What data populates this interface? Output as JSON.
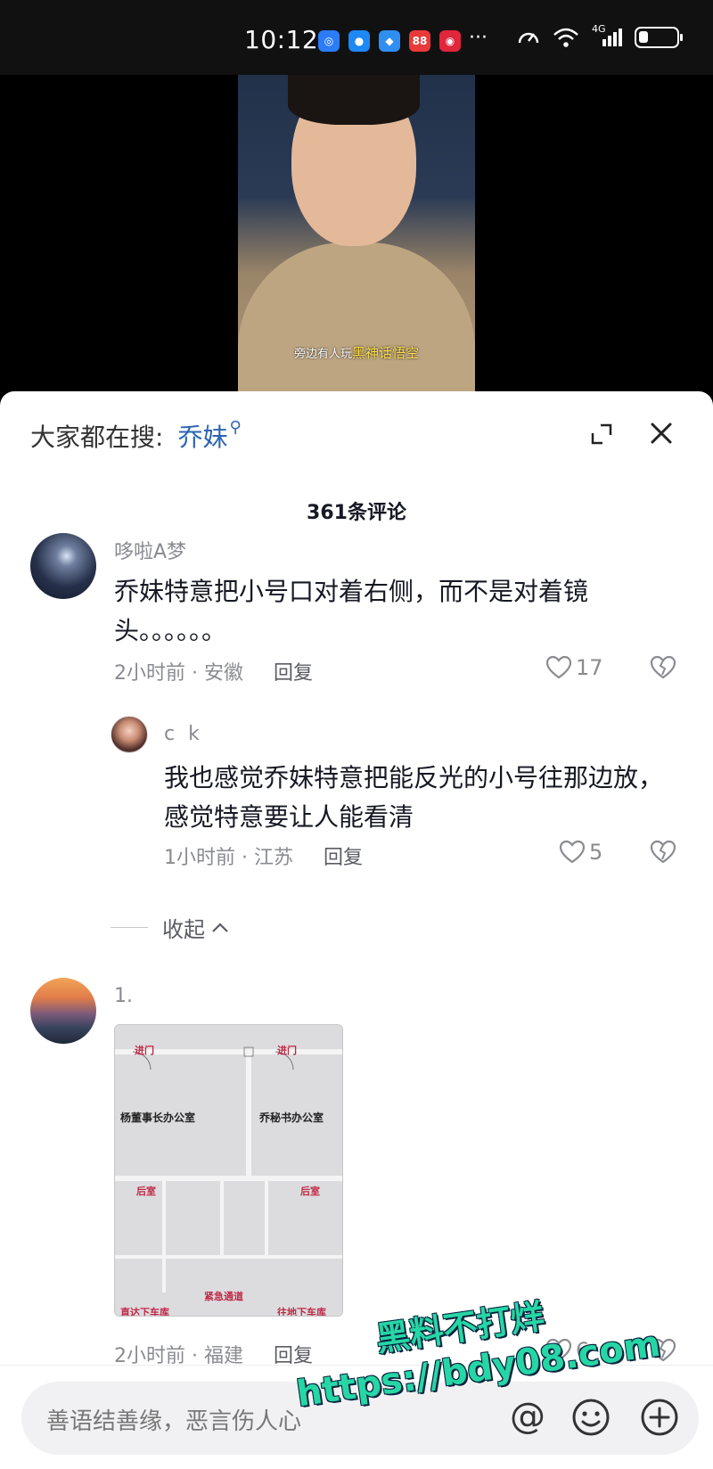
{
  "status_bar": {
    "time": "10:12",
    "notification_icons": [
      {
        "name": "app-icon-blue-1",
        "color": "#2b7cf6",
        "glyph": "◎"
      },
      {
        "name": "message-icon",
        "color": "#1e88f5",
        "glyph": "●"
      },
      {
        "name": "app-icon-blue-2",
        "color": "#2f8ef2",
        "glyph": "◆"
      },
      {
        "name": "app-icon-red-1",
        "color": "#e83a3a",
        "glyph": "88"
      },
      {
        "name": "app-icon-red-2",
        "color": "#e0263b",
        "glyph": "◉"
      }
    ],
    "more": "···",
    "network": "4G"
  },
  "video": {
    "subtitle_prefix": "旁边有人玩",
    "subtitle_highlight": "黑神话悟空"
  },
  "panel": {
    "search_label": "大家都在搜:",
    "search_term": "乔妹",
    "comments_count": "361条评论"
  },
  "comments": [
    {
      "username": "哆啦A梦",
      "text": "乔妹特意把小号口对着右侧，而不是对着镜头。。。。。。",
      "time_location": "2小时前 · 安徽",
      "reply_label": "回复",
      "likes": "17"
    },
    {
      "username": "c k",
      "text": "我也感觉乔妹特意把能反光的小号往那边放，感觉特意要让人能看清",
      "time_location": "1小时前 · 江苏",
      "reply_label": "回复",
      "likes": "5"
    },
    {
      "username": "1.",
      "time_location": "2小时前 · 福建",
      "reply_label": "回复",
      "likes": "6"
    }
  ],
  "collapse_label": "收起",
  "floorplan": {
    "room_left": "杨董事长办公室",
    "room_right": "乔秘书办公室",
    "door_left": "进门",
    "door_right": "进门",
    "rest_left": "后室",
    "rest_right": "后室",
    "emergency": "紧急通道",
    "garage_left": "直达下车库",
    "garage_right": "往地下车库"
  },
  "input": {
    "placeholder": "善语结善缘，恶言伤人心"
  },
  "watermark": {
    "line1": "黑料不打烊",
    "line2": "https://bdy08.com"
  }
}
